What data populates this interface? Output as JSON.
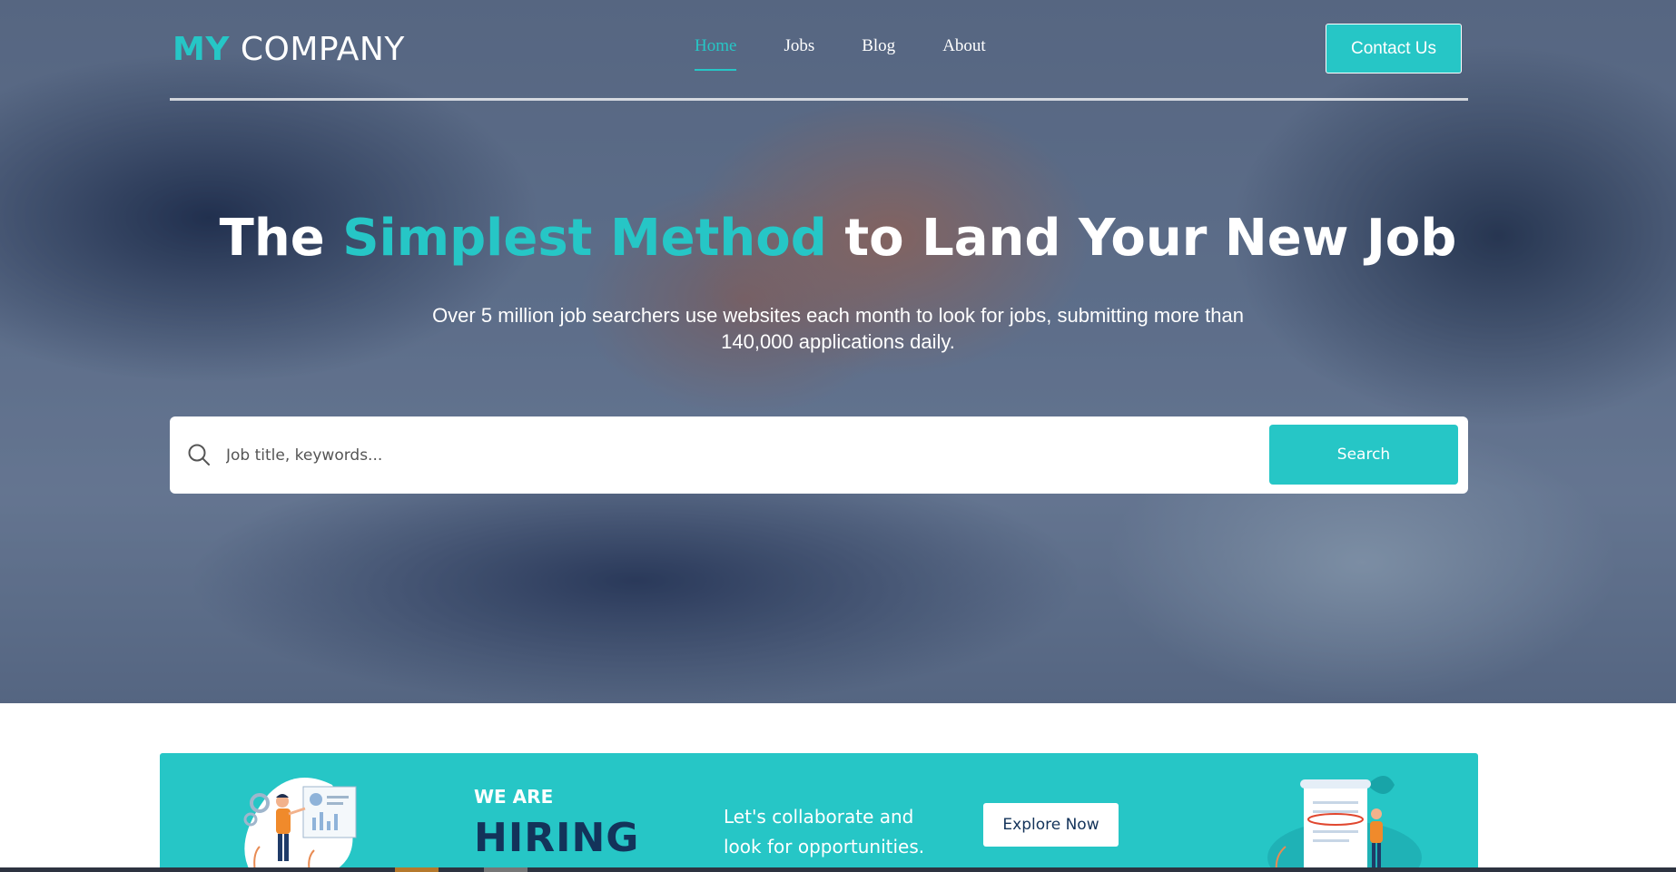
{
  "header": {
    "logo_accent": "MY",
    "logo_rest": "COMPANY",
    "nav": [
      {
        "label": "Home",
        "active": true
      },
      {
        "label": "Jobs",
        "active": false
      },
      {
        "label": "Blog",
        "active": false
      },
      {
        "label": "About",
        "active": false
      }
    ],
    "contact_label": "Contact Us"
  },
  "hero": {
    "title_part1": "The ",
    "title_highlight": "Simplest Method",
    "title_part2": " to Land Your New Job",
    "subtitle": "Over 5 million job searchers use websites each month to look for jobs, submitting more than 140,000 applications daily.",
    "search": {
      "placeholder": "Job title, keywords...",
      "button_label": "Search"
    }
  },
  "hiring_banner": {
    "eyebrow": "WE ARE",
    "headline": "HIRING",
    "text": "Let's collaborate and look for opportunities.",
    "button_label": "Explore Now"
  },
  "colors": {
    "accent": "#26c6c6",
    "navy": "#13335a"
  },
  "icons": [
    "search-icon"
  ]
}
